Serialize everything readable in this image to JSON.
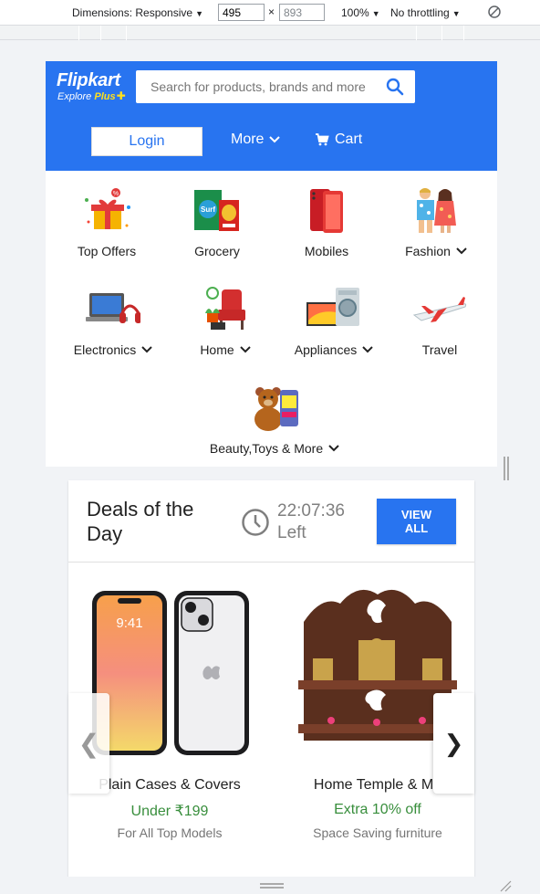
{
  "devtools": {
    "dimensions_label": "Dimensions: Responsive",
    "width_value": "495",
    "height_value": "893",
    "times": "×",
    "zoom_label": "100%",
    "throttle_label": "No throttling"
  },
  "header": {
    "logo_text": "Flipkart",
    "logo_sub_explore": "Explore",
    "logo_sub_plus": "Plus",
    "search_placeholder": "Search for products, brands and more",
    "login_label": "Login",
    "more_label": "More",
    "cart_label": "Cart",
    "brand_color": "#2874f0"
  },
  "categories": [
    {
      "label": "Top Offers",
      "icon": "gift-offers-icon",
      "has_dropdown": false
    },
    {
      "label": "Grocery",
      "icon": "grocery-icon",
      "has_dropdown": false
    },
    {
      "label": "Mobiles",
      "icon": "mobile-phone-icon",
      "has_dropdown": false
    },
    {
      "label": "Fashion",
      "icon": "fashion-icon",
      "has_dropdown": true
    },
    {
      "label": "Electronics",
      "icon": "laptop-headphones-icon",
      "has_dropdown": true
    },
    {
      "label": "Home",
      "icon": "home-furniture-icon",
      "has_dropdown": true
    },
    {
      "label": "Appliances",
      "icon": "tv-washer-icon",
      "has_dropdown": true
    },
    {
      "label": "Travel",
      "icon": "airplane-icon",
      "has_dropdown": false
    },
    {
      "label": "Beauty,Toys & More",
      "icon": "teddy-bear-icon",
      "has_dropdown": true
    }
  ],
  "deals": {
    "title": "Deals of the Day",
    "timer": "22:07:36",
    "timer_suffix": "Left",
    "view_all_label": "VIEW ALL",
    "prev_arrow": "❮",
    "next_arrow": "❯",
    "items": [
      {
        "name": "Plain Cases & Covers",
        "offer": "Under ₹199",
        "subtitle": "For All Top Models"
      },
      {
        "name": "Home Temple & Mo",
        "offer": "Extra 10% off",
        "subtitle": "Space Saving furniture"
      }
    ],
    "offer_color": "#388e3c"
  }
}
